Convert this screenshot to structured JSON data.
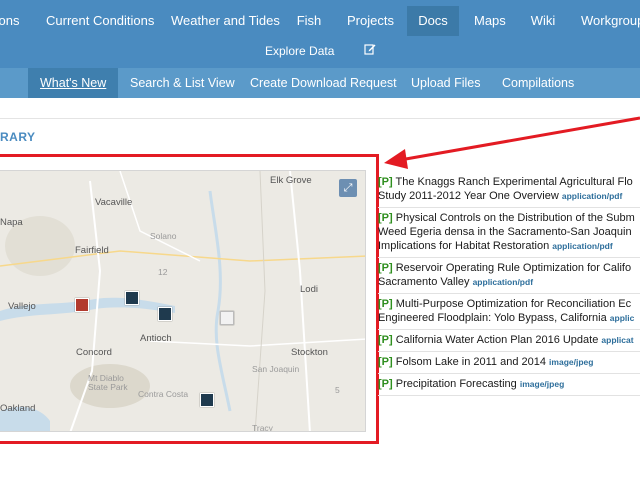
{
  "nav": {
    "items": [
      {
        "label": "ons"
      },
      {
        "label": "Current Conditions"
      },
      {
        "label": "Weather and Tides"
      },
      {
        "label": "Fish"
      },
      {
        "label": "Projects"
      },
      {
        "label": "Docs"
      },
      {
        "label": "Maps"
      },
      {
        "label": "Wiki"
      },
      {
        "label": "Workgroup"
      }
    ],
    "explore": "Explore Data",
    "edit_icon": "edit-icon"
  },
  "subnav": {
    "items": [
      {
        "label": "What's New"
      },
      {
        "label": "Search & List View"
      },
      {
        "label": "Create Download Request"
      },
      {
        "label": "Upload Files"
      },
      {
        "label": "Compilations"
      }
    ]
  },
  "section_title": "RARY",
  "map": {
    "labels": {
      "elk_grove": "Elk Grove",
      "vacaville": "Vacaville",
      "napa": "Napa",
      "solano": "Solano",
      "fairfield": "Fairfield",
      "vallejo": "Vallejo",
      "lodi": "Lodi",
      "antioch": "Antioch",
      "concord": "Concord",
      "stockton": "Stockton",
      "san_joaquin": "San Joaquin",
      "mt_diablo": "Mt Diablo State Park",
      "contra_costa": "Contra Costa",
      "oakland": "Oakland",
      "tracy": "Tracy",
      "road_12": "12",
      "road_5": "5"
    },
    "expand_icon": "expand-icon"
  },
  "docs": [
    {
      "tag": "[P]",
      "title": "The Knaggs Ranch Experimental Agricultural Flo",
      "title2": "Study 2011-2012 Year One Overview",
      "mime": "application/pdf"
    },
    {
      "tag": "[P]",
      "title": "Physical Controls on the Distribution of the Subm",
      "title2": "Weed Egeria densa in the Sacramento-San Joaquin",
      "title3": "Implications for Habitat Restoration",
      "mime": "application/pdf"
    },
    {
      "tag": "[P]",
      "title": "Reservoir Operating Rule Optimization for Califo",
      "title2": "Sacramento Valley",
      "mime": "application/pdf"
    },
    {
      "tag": "[P]",
      "title": "Multi-Purpose Optimization for Reconciliation Ec",
      "title2": "Engineered Floodplain: Yolo Bypass, California",
      "mime": "applic"
    },
    {
      "tag": "[P]",
      "title": "California Water Action Plan 2016 Update",
      "mime": "applicat"
    },
    {
      "tag": "[P]",
      "title": "Folsom Lake in 2011 and 2014",
      "mime": "image/jpeg"
    },
    {
      "tag": "[P]",
      "title": "Precipitation Forecasting",
      "mime": "image/jpeg"
    }
  ],
  "colors": {
    "nav_bg": "#4a8bc0",
    "subnav_bg": "#5b9ac9",
    "highlight_red": "#e31b23",
    "tag_green": "#2f8f1f"
  }
}
